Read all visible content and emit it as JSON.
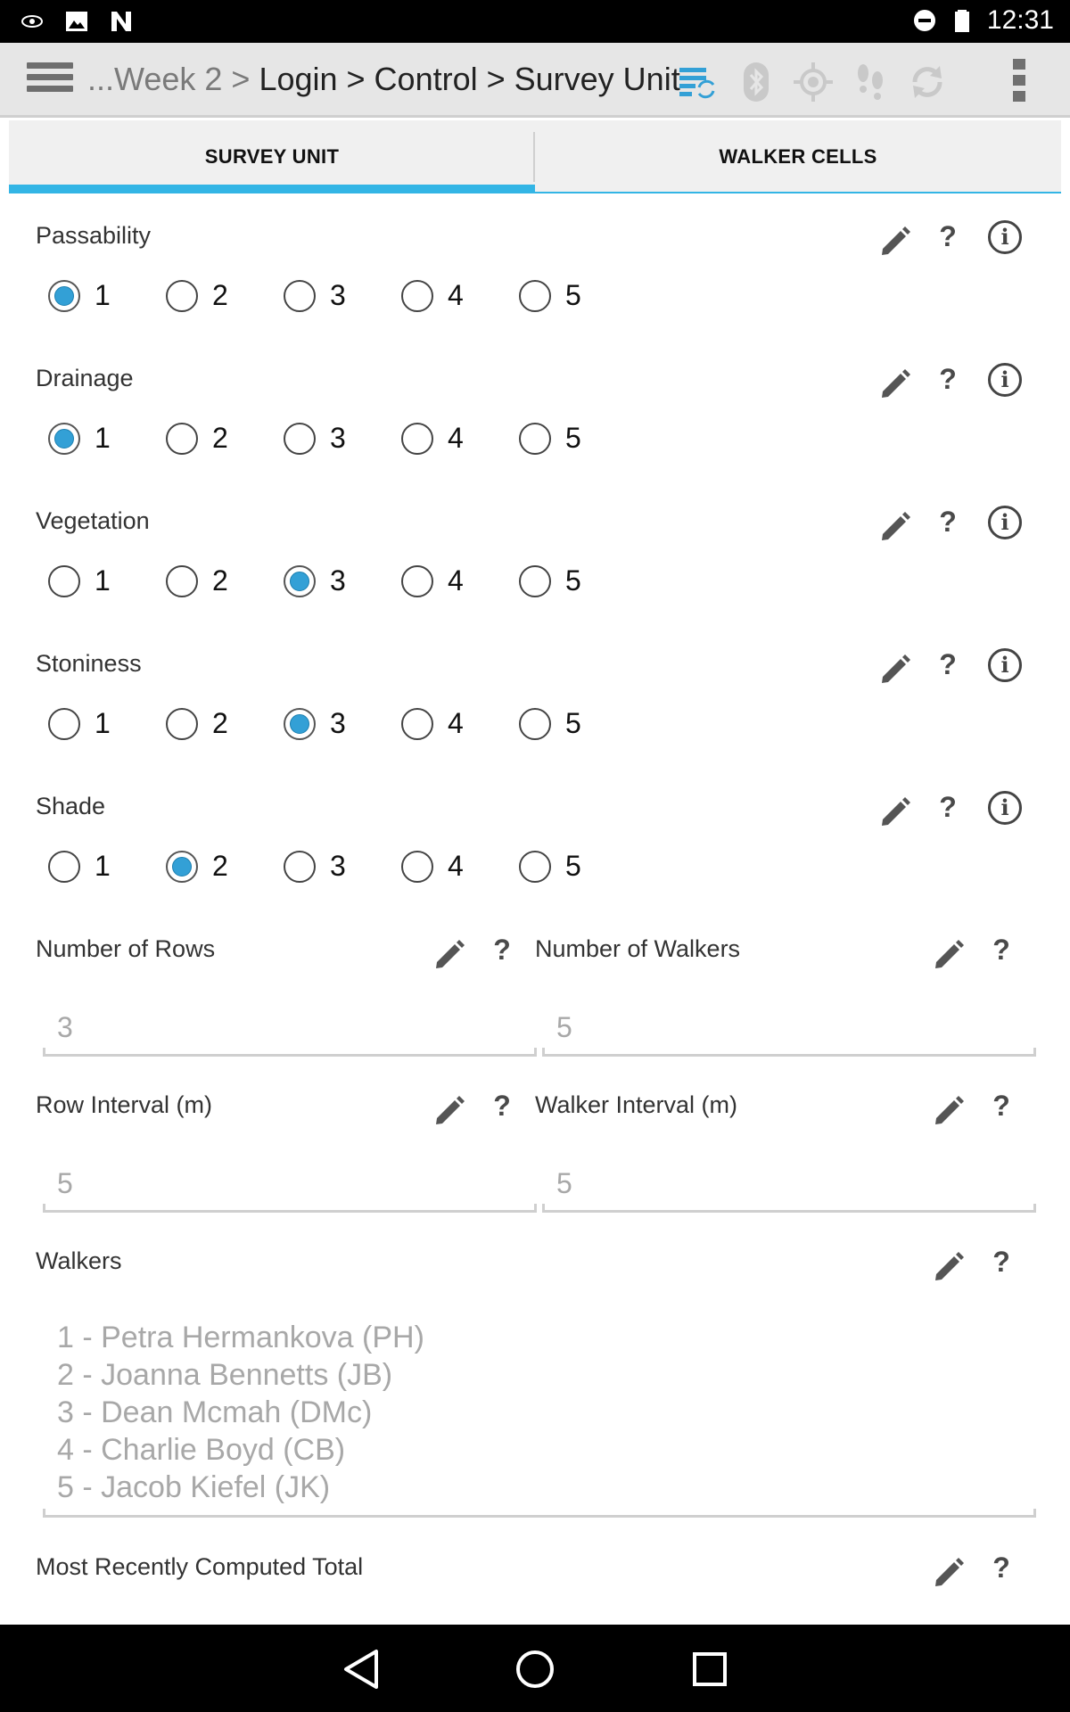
{
  "status_bar": {
    "time": "12:31",
    "icons": [
      "eye-icon",
      "image-icon",
      "nvidia-icon",
      "do-not-disturb-icon",
      "battery-icon"
    ]
  },
  "action_bar": {
    "breadcrumb_prefix": "...Week 2 > ",
    "breadcrumb_main": "Login > Control > Survey Unit",
    "icons": [
      "sync-database-icon",
      "bluetooth-icon",
      "gps-icon",
      "footsteps-icon",
      "refresh-icon",
      "overflow-menu-icon"
    ]
  },
  "tabs": [
    {
      "label": "SURVEY UNIT",
      "active": true
    },
    {
      "label": "WALKER CELLS",
      "active": false
    }
  ],
  "questions": [
    {
      "label": "Passability",
      "options": [
        "1",
        "2",
        "3",
        "4",
        "5"
      ],
      "selected": "1"
    },
    {
      "label": "Drainage",
      "options": [
        "1",
        "2",
        "3",
        "4",
        "5"
      ],
      "selected": "1"
    },
    {
      "label": "Vegetation",
      "options": [
        "1",
        "2",
        "3",
        "4",
        "5"
      ],
      "selected": "3"
    },
    {
      "label": "Stoniness",
      "options": [
        "1",
        "2",
        "3",
        "4",
        "5"
      ],
      "selected": "3"
    },
    {
      "label": "Shade",
      "options": [
        "1",
        "2",
        "3",
        "4",
        "5"
      ],
      "selected": "2"
    }
  ],
  "fields": {
    "number_of_rows": {
      "label": "Number of Rows",
      "value": "3"
    },
    "number_of_walkers": {
      "label": "Number of Walkers",
      "value": "5"
    },
    "row_interval": {
      "label": "Row Interval (m)",
      "value": "5"
    },
    "walker_interval": {
      "label": "Walker Interval (m)",
      "value": "5"
    }
  },
  "walkers": {
    "label": "Walkers",
    "items": [
      "1 - Petra Hermankova (PH)",
      "2 - Joanna Bennetts (JB)",
      "3 - Dean Mcmah (DMc)",
      "4 - Charlie Boyd (CB)",
      "5 - Jacob Kiefel (JK)"
    ]
  },
  "total": {
    "label": "Most Recently Computed Total"
  },
  "help_symbol": "?",
  "info_symbol": "i",
  "colors": {
    "accent": "#33b5e5",
    "radio_fill": "#33a0d6",
    "hint_text": "#a8a8a8"
  }
}
